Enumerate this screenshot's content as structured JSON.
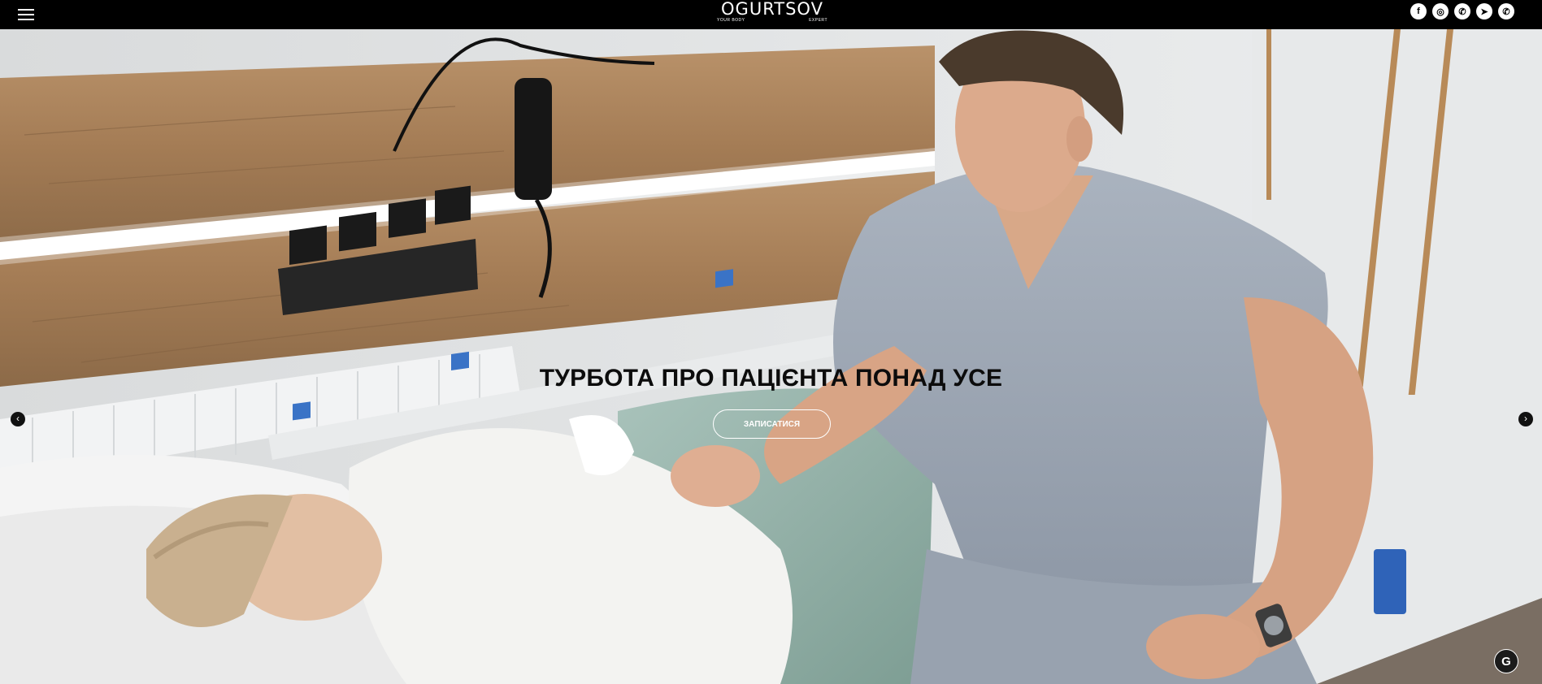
{
  "header": {
    "logo": {
      "name": "OGURTSOV",
      "tagline_left": "YOUR BODY",
      "tagline_right": "EXPERT"
    },
    "social_icons": [
      {
        "icon": "facebook-icon",
        "glyph": "f"
      },
      {
        "icon": "instagram-icon",
        "glyph": "◎"
      },
      {
        "icon": "phone-icon",
        "glyph": "✆"
      },
      {
        "icon": "telegram-icon",
        "glyph": "➤"
      },
      {
        "icon": "viber-icon",
        "glyph": "✆"
      }
    ]
  },
  "hero": {
    "headline": "ТУРБОТА ПРО ПАЦІЄНТА ПОНАД УСЕ",
    "cta_label": "ЗАПИСАТИСЯ",
    "prev_glyph": "‹",
    "next_glyph": "›",
    "image": "doctor-with-patient-photo"
  },
  "widget": {
    "glyph": "G"
  }
}
